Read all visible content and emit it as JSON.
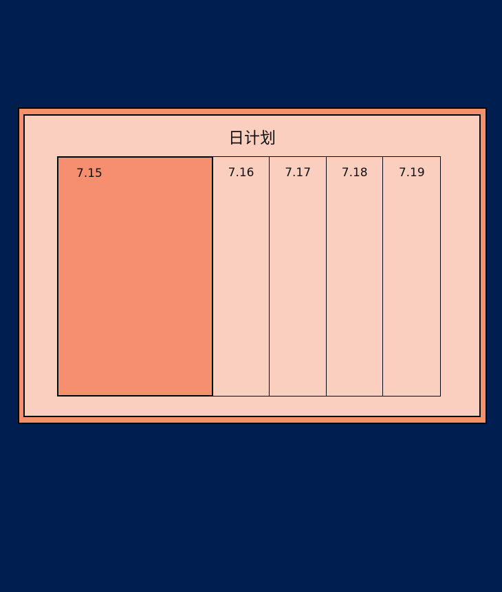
{
  "card": {
    "title": "日计划"
  },
  "days": [
    {
      "label": "7.15",
      "selected": true
    },
    {
      "label": "7.16",
      "selected": false
    },
    {
      "label": "7.17",
      "selected": false
    },
    {
      "label": "7.18",
      "selected": false
    },
    {
      "label": "7.19",
      "selected": false
    }
  ],
  "colors": {
    "background": "#001e4f",
    "accent": "#f68f6f",
    "panel": "#facfbf",
    "border": "#000000"
  }
}
